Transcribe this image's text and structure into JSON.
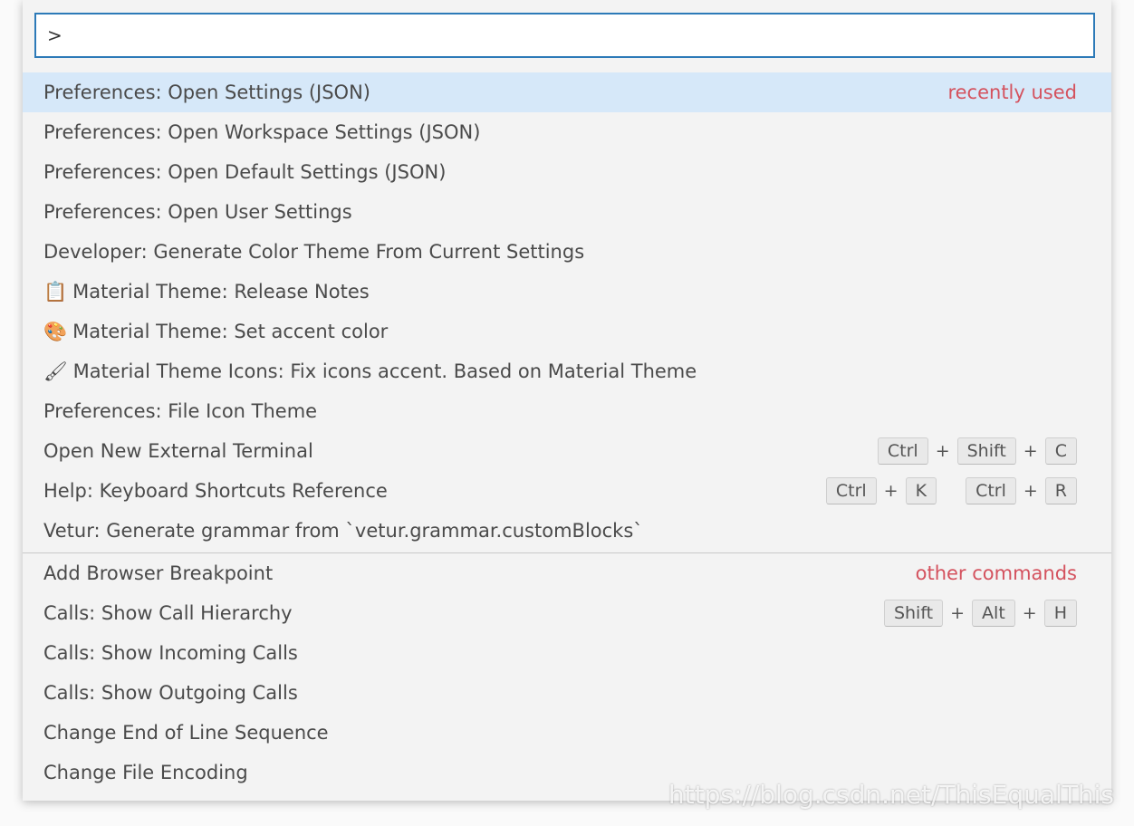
{
  "input": {
    "value": ">",
    "placeholder": ""
  },
  "recent": [
    {
      "label": "Preferences: Open Settings (JSON)",
      "tag": "recently used",
      "selected": true
    },
    {
      "label": "Preferences: Open Workspace Settings (JSON)"
    },
    {
      "label": "Preferences: Open Default Settings (JSON)"
    },
    {
      "label": "Preferences: Open User Settings"
    },
    {
      "label": "Developer: Generate Color Theme From Current Settings"
    },
    {
      "label": "Material Theme: Release Notes",
      "icon": "clipboard-icon",
      "glyph": "📋"
    },
    {
      "label": "Material Theme: Set accent color",
      "icon": "palette-icon",
      "glyph": "🎨"
    },
    {
      "label": "Material Theme Icons: Fix icons accent. Based on Material Theme",
      "icon": "paintbrush-icon",
      "glyph": "🖌"
    },
    {
      "label": "Preferences: File Icon Theme"
    },
    {
      "label": "Open New External Terminal",
      "keys": [
        [
          "Ctrl",
          "Shift",
          "C"
        ]
      ]
    },
    {
      "label": "Help: Keyboard Shortcuts Reference",
      "keys": [
        [
          "Ctrl",
          "K"
        ],
        [
          "Ctrl",
          "R"
        ]
      ]
    },
    {
      "label": "Vetur: Generate grammar from `vetur.grammar.customBlocks`"
    }
  ],
  "other": [
    {
      "label": "Add Browser Breakpoint",
      "tag": "other commands"
    },
    {
      "label": "Calls: Show Call Hierarchy",
      "keys": [
        [
          "Shift",
          "Alt",
          "H"
        ]
      ]
    },
    {
      "label": "Calls: Show Incoming Calls"
    },
    {
      "label": "Calls: Show Outgoing Calls"
    },
    {
      "label": "Change End of Line Sequence"
    },
    {
      "label": "Change File Encoding"
    }
  ],
  "watermark": "https://blog.csdn.net/ThisEqualThis",
  "colors": {
    "accent": "#2d7ab8",
    "selected": "#d6e8f9",
    "tag": "#d4525e"
  }
}
